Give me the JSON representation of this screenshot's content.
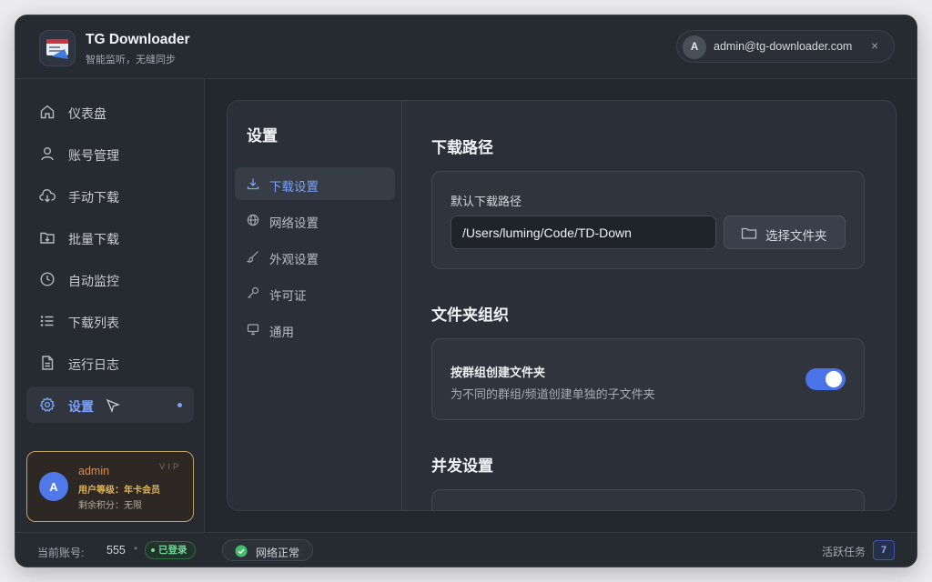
{
  "app": {
    "title": "TG Downloader",
    "subtitle": "智能监听，无缝同步"
  },
  "account": {
    "avatar_letter": "A",
    "email": "admin@tg-downloader.com",
    "close_glyph": "×"
  },
  "sidebar": {
    "items": [
      {
        "label": "仪表盘",
        "icon": "home-icon"
      },
      {
        "label": "账号管理",
        "icon": "user-icon"
      },
      {
        "label": "手动下载",
        "icon": "cloud-download-icon"
      },
      {
        "label": "批量下载",
        "icon": "folder-download-icon"
      },
      {
        "label": "自动监控",
        "icon": "clock-icon"
      },
      {
        "label": "下载列表",
        "icon": "list-icon"
      },
      {
        "label": "运行日志",
        "icon": "document-icon"
      },
      {
        "label": "设置",
        "icon": "gear-icon",
        "active": true
      }
    ]
  },
  "vip_card": {
    "avatar_letter": "A",
    "name": "admin",
    "badge": "VIP",
    "level": "用户等级：年卡会员",
    "points": "剩余积分：无限"
  },
  "settings": {
    "title": "设置",
    "nav": [
      {
        "label": "下载设置",
        "icon": "download-icon",
        "active": true
      },
      {
        "label": "网络设置",
        "icon": "globe-icon"
      },
      {
        "label": "外观设置",
        "icon": "brush-icon"
      },
      {
        "label": "许可证",
        "icon": "key-icon"
      },
      {
        "label": "通用",
        "icon": "monitor-icon"
      }
    ],
    "download_path": {
      "section_title": "下载路径",
      "field_label": "默认下载路径",
      "value": "/Users/luming/Code/TD-Down",
      "choose_label": "选择文件夹"
    },
    "folder_org": {
      "section_title": "文件夹组织",
      "toggle_title": "按群组创建文件夹",
      "toggle_desc": "为不同的群组/频道创建单独的子文件夹",
      "enabled": true
    },
    "concurrency": {
      "section_title": "并发设置"
    }
  },
  "footer": {
    "account_label": "当前账号:",
    "account_value": "555",
    "separator": "•",
    "logged_in": "已登录",
    "network": "网络正常",
    "tasks_label": "活跃任务",
    "tasks_count": "7"
  },
  "colors": {
    "accent": "#7aa2f7",
    "toggle_on": "#4a73e8",
    "vip_border": "#c4a166",
    "success": "#72d79a"
  }
}
